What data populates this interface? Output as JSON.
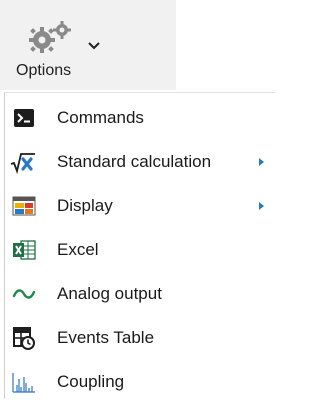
{
  "ribbon": {
    "label": "Options",
    "icon": "gears-icon",
    "dropdown_icon": "chevron-down-icon"
  },
  "menu": {
    "items": [
      {
        "label": "Commands",
        "icon": "command-prompt-icon",
        "submenu": false
      },
      {
        "label": "Standard calculation",
        "icon": "sqrt-x-icon",
        "submenu": true
      },
      {
        "label": "Display",
        "icon": "display-window-icon",
        "submenu": true
      },
      {
        "label": "Excel",
        "icon": "excel-icon",
        "submenu": false
      },
      {
        "label": "Analog output",
        "icon": "wave-icon",
        "submenu": false
      },
      {
        "label": "Events Table",
        "icon": "events-table-icon",
        "submenu": false
      },
      {
        "label": "Coupling",
        "icon": "coupling-spectrum-icon",
        "submenu": false
      }
    ]
  },
  "colors": {
    "accent_blue": "#2b78c5",
    "excel_green": "#1e7145",
    "wave_green": "#1e8a4a",
    "icon_dark": "#1d1d1d",
    "gear_gray": "#8a8a8a"
  }
}
